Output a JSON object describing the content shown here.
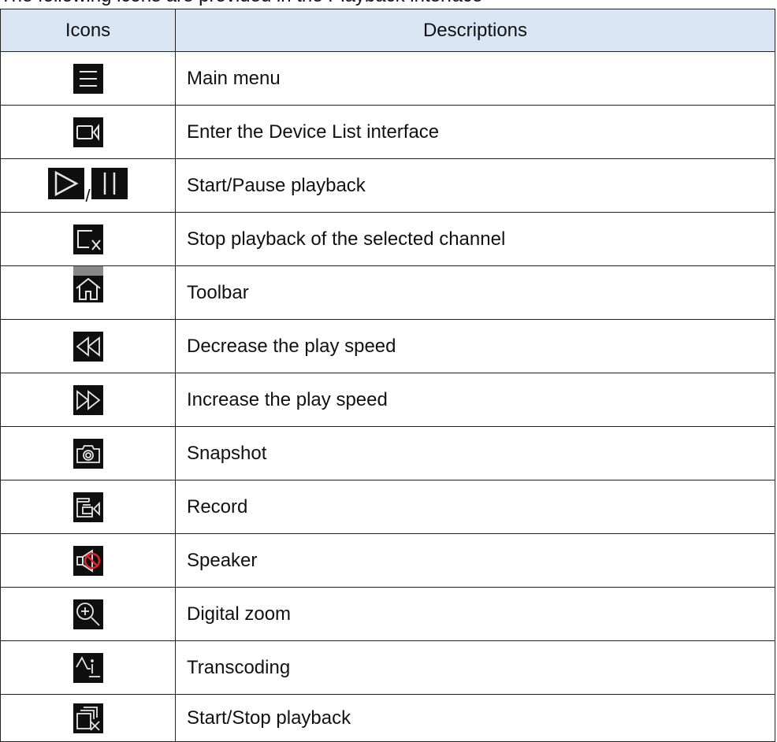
{
  "intro_text": "The following icons are provided in the Playback interface",
  "table": {
    "headers": {
      "icons": "Icons",
      "descriptions": "Descriptions"
    },
    "rows": [
      {
        "icon": "menu-icon",
        "description": "Main menu"
      },
      {
        "icon": "device-list-icon",
        "description": "Enter the Device List interface"
      },
      {
        "icon": "play-pause-icon",
        "separator": "/",
        "description": "Start/Pause playback"
      },
      {
        "icon": "stop-channel-icon",
        "description": "Stop playback of the selected channel"
      },
      {
        "icon": "toolbar-home-icon",
        "description": "Toolbar"
      },
      {
        "icon": "rewind-icon",
        "description": "Decrease the play speed"
      },
      {
        "icon": "fast-forward-icon",
        "description": "Increase the play speed"
      },
      {
        "icon": "camera-icon",
        "description": "Snapshot"
      },
      {
        "icon": "record-icon",
        "description": "Record"
      },
      {
        "icon": "speaker-muted-icon",
        "description": "Speaker"
      },
      {
        "icon": "zoom-in-icon",
        "description": "Digital zoom"
      },
      {
        "icon": "transcoding-icon",
        "description": "Transcoding"
      },
      {
        "icon": "start-stop-all-icon",
        "description": "Start/Stop playback"
      }
    ]
  },
  "colors": {
    "header_bg": "#d9e5f3",
    "icon_bg": "#0f0f0f",
    "icon_stroke": "#e6e6e6",
    "mute_red": "#e0262b"
  }
}
